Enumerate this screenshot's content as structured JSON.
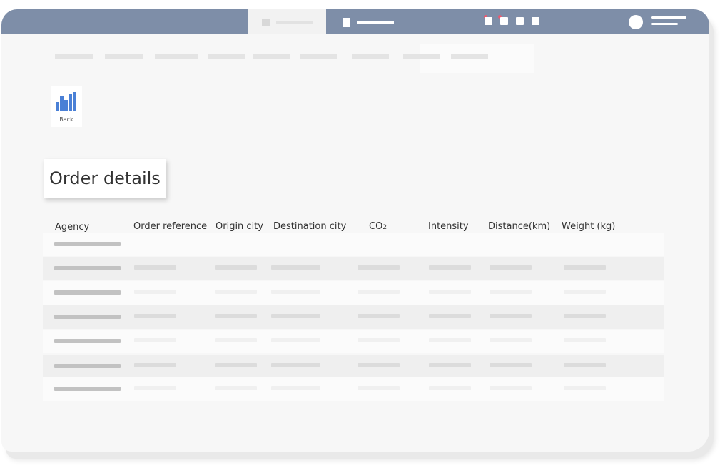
{
  "page": {
    "title": "Order details",
    "back_label": "Back"
  },
  "colors": {
    "titlebar": "#7e8ea8",
    "accent_chart": "#4a80d6",
    "window_dot": "#e85a71"
  },
  "table": {
    "columns": [
      {
        "label": "Agency"
      },
      {
        "label": "Order reference"
      },
      {
        "label": "Origin city"
      },
      {
        "label": "Destination city"
      },
      {
        "label": "CO",
        "subscript": "2"
      },
      {
        "label": "Intensity"
      },
      {
        "label": "Distance(km)"
      },
      {
        "label": "Weight (kg)"
      }
    ]
  }
}
